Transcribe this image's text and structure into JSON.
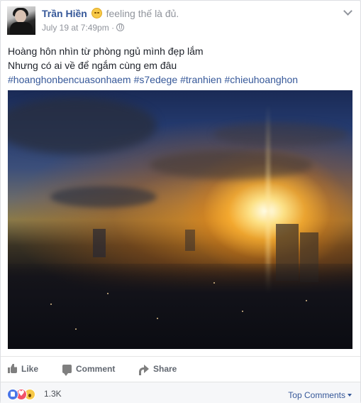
{
  "post": {
    "author": "Trần Hiền",
    "feeling_icon": "relieved-face-icon",
    "feeling": "feeling thế là đủ.",
    "timestamp": "July 19 at 7:49pm",
    "separator": "·",
    "privacy_icon": "globe-icon",
    "text_lines": [
      "Hoàng hôn nhìn từ phòng ngủ mình đẹp lắm",
      "Nhưng có ai về để ngắm cùng em đâu"
    ],
    "hashtags": [
      "#hoanghonbencuasonhaem",
      "#s7edege",
      "#tranhien",
      "#chieuhoanghon"
    ]
  },
  "actions": {
    "like_label": "Like",
    "comment_label": "Comment",
    "share_label": "Share"
  },
  "reactions": {
    "icons": [
      "like-reaction-icon",
      "love-reaction-icon",
      "wow-reaction-icon"
    ],
    "count": "1.3K",
    "sort_label": "Top Comments"
  },
  "colors": {
    "link": "#365899",
    "muted": "#90949c",
    "action": "#616770"
  }
}
